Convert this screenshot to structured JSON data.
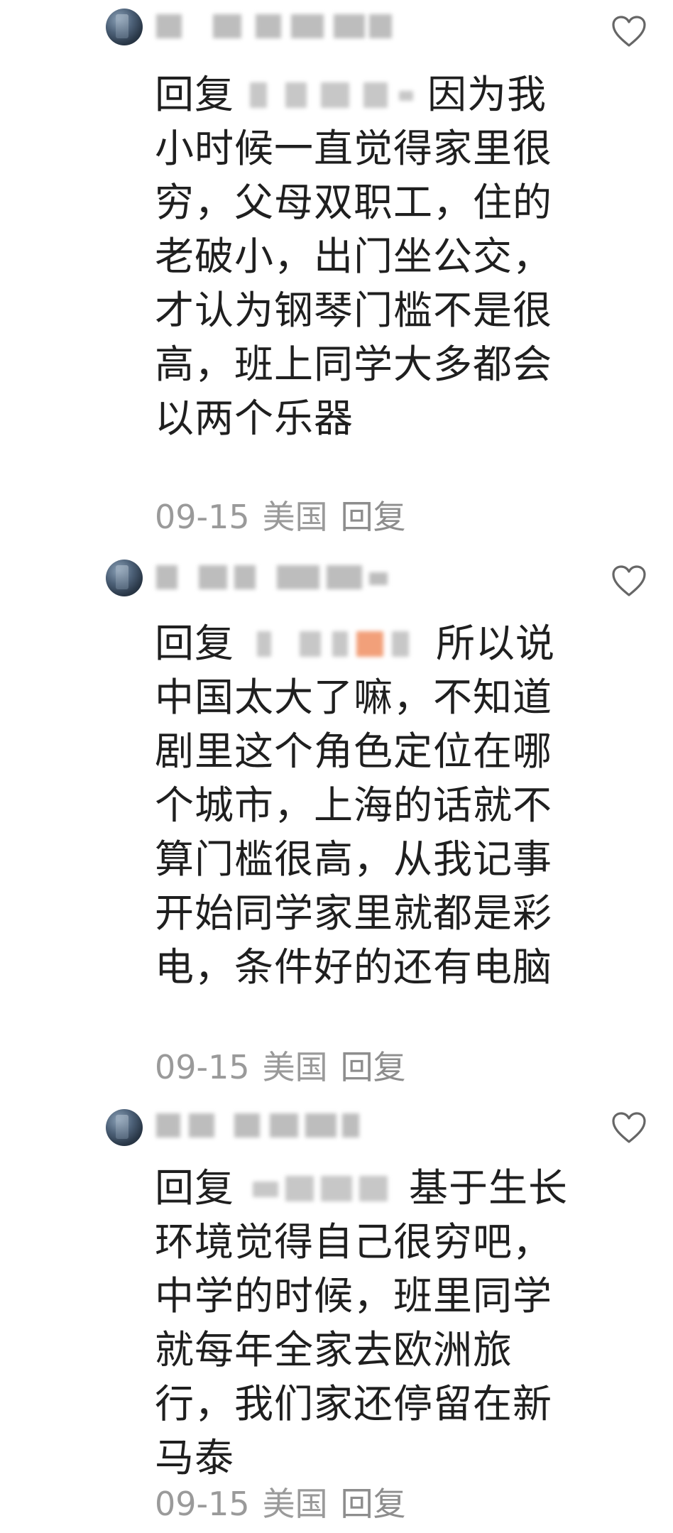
{
  "replies": [
    {
      "reply_prefix": "回复",
      "text": "因为我小时候一直觉得家里很穷，父母双职工，住的老破小，出门坐公交，才认为钢琴门槛不是很高，班上同学大多都会以两个乐器",
      "date": "09-15",
      "location": "美国",
      "reply_label": "回复"
    },
    {
      "reply_prefix": "回复",
      "text": "所以说中国太大了嘛，不知道剧里这个角色定位在哪个城市，上海的话就不算门槛很高，从我记事开始同学家里就都是彩电，条件好的还有电脑",
      "date": "09-15",
      "location": "美国",
      "reply_label": "回复"
    },
    {
      "reply_prefix": "回复",
      "text": "基于生长环境觉得自己很穷吧，中学的时候，班里同学就每年全家去欧洲旅行，我们家还停留在新马泰",
      "date": "09-15",
      "location": "美国",
      "reply_label": "回复"
    }
  ],
  "icons": {
    "like": "heart-outline-icon",
    "avatar": "user-avatar"
  },
  "colors": {
    "text": "#1f1f1f",
    "meta": "#9a9a9a",
    "heart_stroke": "#666666",
    "background": "#ffffff"
  }
}
